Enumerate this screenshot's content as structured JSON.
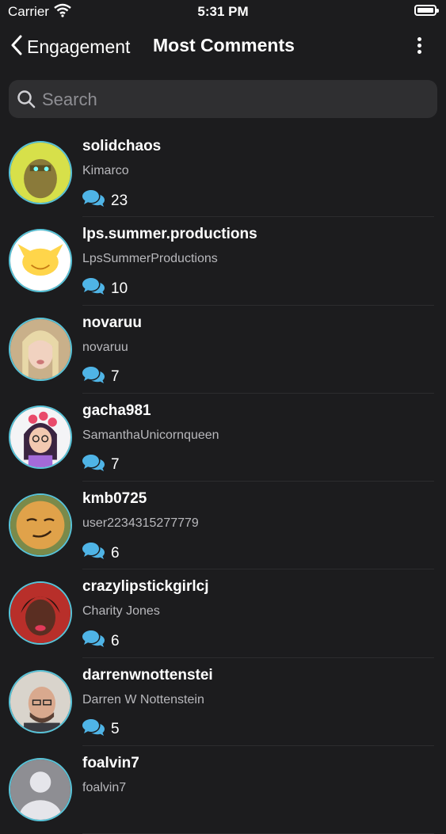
{
  "status_bar": {
    "carrier": "Carrier",
    "time": "5:31 PM"
  },
  "nav": {
    "back_label": "Engagement",
    "title": "Most Comments"
  },
  "search": {
    "placeholder": "Search"
  },
  "colors": {
    "accent": "#58c3d8",
    "comment_icon": "#4fb4e6",
    "background": "#1c1c1e"
  },
  "users": [
    {
      "username": "solidchaos",
      "display_name": "Kimarco",
      "comments": "23"
    },
    {
      "username": "lps.summer.productions",
      "display_name": "LpsSummerProductions",
      "comments": "10"
    },
    {
      "username": "novaruu",
      "display_name": "novaruu",
      "comments": "7"
    },
    {
      "username": "gacha981",
      "display_name": "SamanthaUnicornqueen",
      "comments": "7"
    },
    {
      "username": "kmb0725",
      "display_name": "user2234315277779",
      "comments": "6"
    },
    {
      "username": "crazylipstickgirlcj",
      "display_name": "Charity Jones",
      "comments": "6"
    },
    {
      "username": "darrenwnottenstei",
      "display_name": "Darren W Nottenstein",
      "comments": "5"
    },
    {
      "username": "foalvin7",
      "display_name": "foalvin7",
      "comments": ""
    }
  ]
}
